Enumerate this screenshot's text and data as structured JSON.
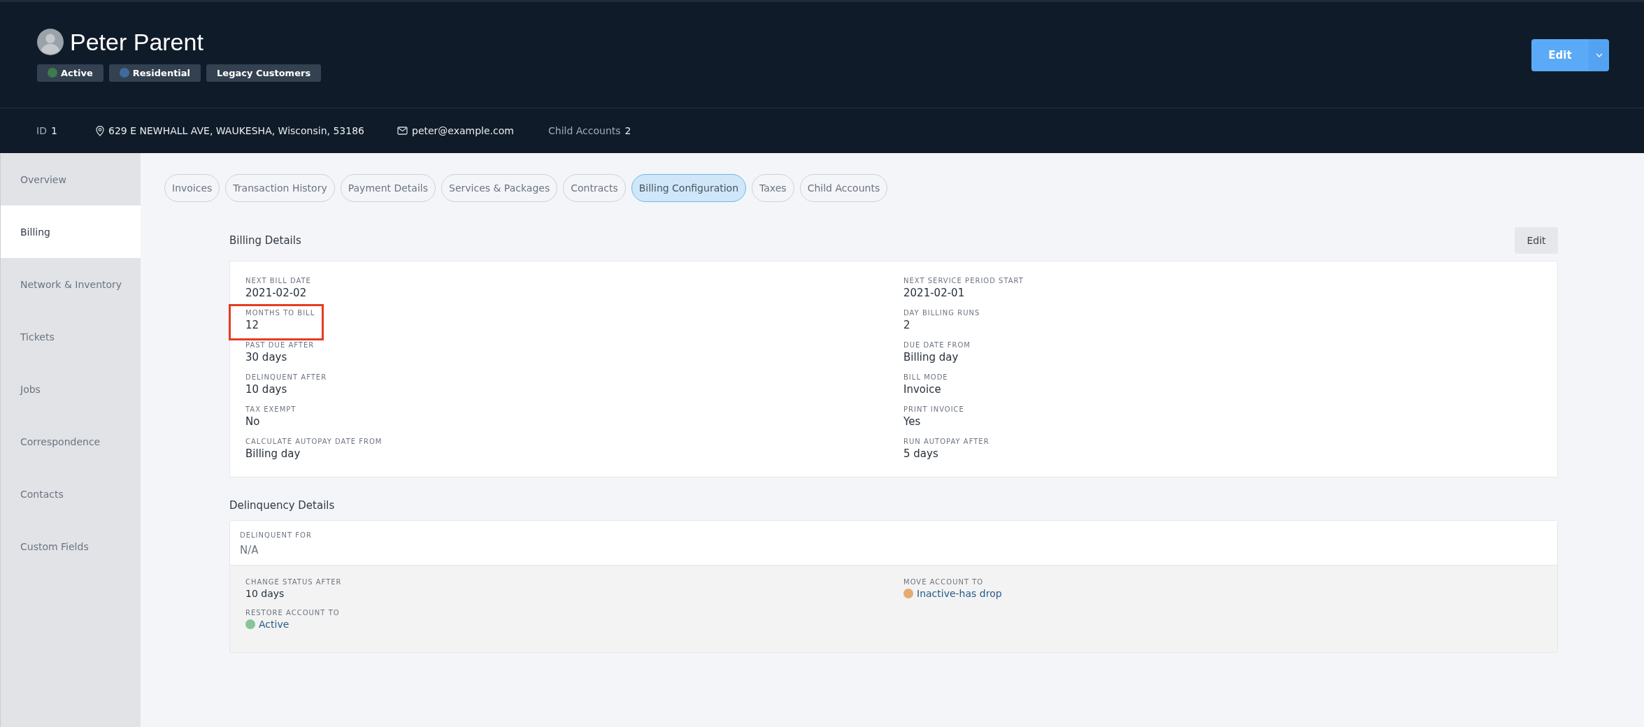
{
  "customer": {
    "name": "Peter Parent",
    "tags": [
      {
        "label": "Active",
        "color": "#3d7a4e"
      },
      {
        "label": "Residential",
        "color": "#3f6a9e"
      },
      {
        "label": "Legacy Customers"
      }
    ],
    "edit_button": "Edit"
  },
  "info_bar": {
    "id_label": "ID",
    "id_value": "1",
    "address": "629 E NEWHALL AVE, WAUKESHA, Wisconsin, 53186",
    "email": "peter@example.com",
    "child_accounts_label": "Child Accounts",
    "child_accounts_value": "2"
  },
  "sidebar": {
    "items": [
      {
        "label": "Overview",
        "selected": false
      },
      {
        "label": "Billing",
        "selected": true
      },
      {
        "label": "Network & Inventory",
        "selected": false
      },
      {
        "label": "Tickets",
        "selected": false
      },
      {
        "label": "Jobs",
        "selected": false
      },
      {
        "label": "Correspondence",
        "selected": false
      },
      {
        "label": "Contacts",
        "selected": false
      },
      {
        "label": "Custom Fields",
        "selected": false
      }
    ]
  },
  "tabs": [
    {
      "label": "Invoices",
      "selected": false
    },
    {
      "label": "Transaction History",
      "selected": false
    },
    {
      "label": "Payment Details",
      "selected": false
    },
    {
      "label": "Services & Packages",
      "selected": false
    },
    {
      "label": "Contracts",
      "selected": false
    },
    {
      "label": "Billing Configuration",
      "selected": true
    },
    {
      "label": "Taxes",
      "selected": false
    },
    {
      "label": "Child Accounts",
      "selected": false
    }
  ],
  "billing_details": {
    "title": "Billing Details",
    "edit_button": "Edit",
    "left_fields": [
      {
        "label": "NEXT BILL DATE",
        "value": "2021-02-02",
        "highlighted": false
      },
      {
        "label": "MONTHS TO BILL",
        "value": "12",
        "highlighted": true
      },
      {
        "label": "PAST DUE AFTER",
        "value": "30 days",
        "highlighted": false
      },
      {
        "label": "DELINQUENT AFTER",
        "value": "10 days",
        "highlighted": false
      },
      {
        "label": "TAX EXEMPT",
        "value": "No",
        "highlighted": false
      },
      {
        "label": "CALCULATE AUTOPAY DATE FROM",
        "value": "Billing day",
        "highlighted": false
      }
    ],
    "right_fields": [
      {
        "label": "NEXT SERVICE PERIOD START",
        "value": "2021-02-01",
        "highlighted": false
      },
      {
        "label": "DAY BILLING RUNS",
        "value": "2",
        "highlighted": false
      },
      {
        "label": "DUE DATE FROM",
        "value": "Billing day",
        "highlighted": false
      },
      {
        "label": "BILL MODE",
        "value": "Invoice",
        "highlighted": false
      },
      {
        "label": "PRINT INVOICE",
        "value": "Yes",
        "highlighted": false
      },
      {
        "label": "RUN AUTOPAY AFTER",
        "value": "5 days",
        "highlighted": false
      }
    ]
  },
  "delinquency_details": {
    "title": "Delinquency Details",
    "delinquent_for": {
      "label": "DELINQUENT FOR",
      "value": "N/A"
    },
    "change_status_after": {
      "label": "CHANGE STATUS AFTER",
      "value": "10 days"
    },
    "restore_account_to": {
      "label": "RESTORE ACCOUNT TO",
      "value": "Active",
      "color": "#86c59a"
    },
    "move_account_to": {
      "label": "MOVE ACCOUNT TO",
      "value": "Inactive-has drop",
      "color": "#e6aa70"
    }
  }
}
